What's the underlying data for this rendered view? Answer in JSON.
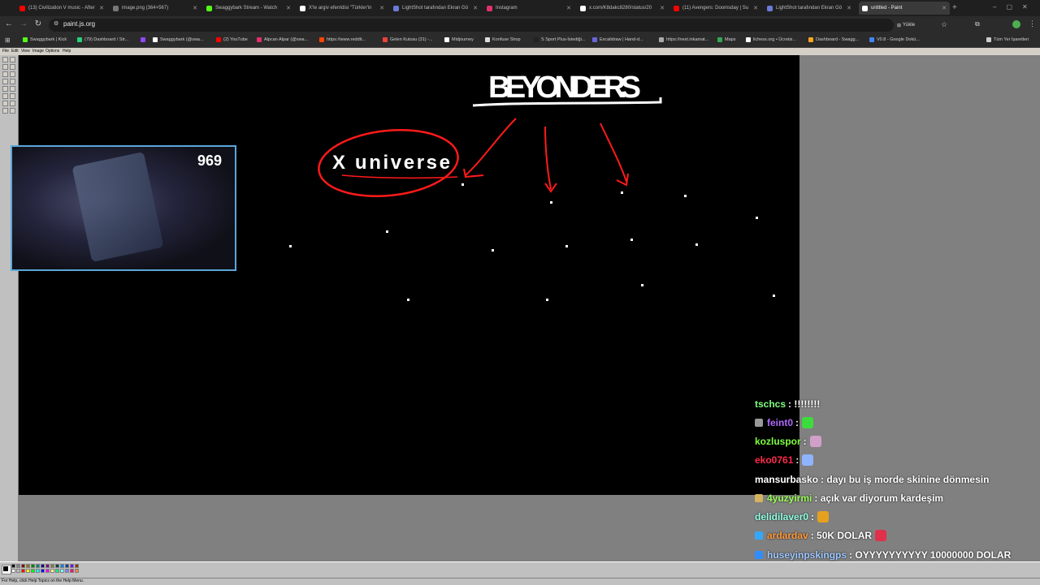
{
  "browser": {
    "tabs": [
      {
        "label": "(13) Civilization V music - After",
        "color": "#ff0000"
      },
      {
        "label": "image.png (364×567)",
        "color": "#777777"
      },
      {
        "label": "Swaggybark Stream - Watch",
        "color": "#53fc18"
      },
      {
        "label": "X'te argiv eferridisi \"Türkler'in",
        "color": "#ffffff"
      },
      {
        "label": "LightShot tarafından Ekran Gö",
        "color": "#6b7bd8"
      },
      {
        "label": "Instagram",
        "color": "#e1306c"
      },
      {
        "label": "x.com/K8dakc8280/status/20",
        "color": "#ffffff"
      },
      {
        "label": "(11) Avengers: Doomsday | Su",
        "color": "#ff0000"
      },
      {
        "label": "LightShot tarafından Ekran Gö",
        "color": "#6b7bd8"
      },
      {
        "label": "untitled - Paint",
        "color": "#ffffff"
      }
    ],
    "url": "paint.js.org",
    "install_label": "Yükle",
    "bookmarks": [
      {
        "label": "Swaggybark | Kick",
        "color": "#53fc18"
      },
      {
        "label": "(79) Dashboard / Str...",
        "color": "#26d07c"
      },
      {
        "label": "",
        "color": "#9146ff"
      },
      {
        "label": "Swaggybark (@swa...",
        "color": "#ffffff"
      },
      {
        "label": "(2) YouTube",
        "color": "#ff0000"
      },
      {
        "label": "Alpcan Alpar (@swa...",
        "color": "#e1306c"
      },
      {
        "label": "https://www.reddit...",
        "color": "#ff4500"
      },
      {
        "label": "Gelen Kutusu (31) -...",
        "color": "#ea4335"
      },
      {
        "label": "Midjourney",
        "color": "#ffffff"
      },
      {
        "label": "Konfuse Shop",
        "color": "#dddddd"
      },
      {
        "label": "S Sport Plus-İstediği...",
        "color": "#222222"
      },
      {
        "label": "Excalidraw | Hand-d...",
        "color": "#6965db"
      },
      {
        "label": "https://next.inkamat...",
        "color": "#aaaaaa"
      },
      {
        "label": "Maps",
        "color": "#34a853"
      },
      {
        "label": "lichess.org • Ücretsi...",
        "color": "#ffffff"
      },
      {
        "label": "Dashboard - Swagg...",
        "color": "#f5a623"
      },
      {
        "label": "V0.8 - Google Dokü...",
        "color": "#4285f4"
      }
    ],
    "all_bookmarks": "Tüm Yer İşaretleri"
  },
  "paint": {
    "menu": [
      "File",
      "Edit",
      "View",
      "Image",
      "Options",
      "Help"
    ],
    "status": "For Help, click Help Topics on the Help Menu.",
    "palette": [
      "#000000",
      "#808080",
      "#800000",
      "#808000",
      "#008000",
      "#008080",
      "#000080",
      "#800080",
      "#808040",
      "#004040",
      "#0080ff",
      "#004080",
      "#8000ff",
      "#804000",
      "#ffffff",
      "#c0c0c0",
      "#ff0000",
      "#ffff00",
      "#00ff00",
      "#00ffff",
      "#0000ff",
      "#ff00ff",
      "#ffff80",
      "#00ff80",
      "#80ffff",
      "#8080ff",
      "#ff0080",
      "#ff8040"
    ],
    "drawing": {
      "heading": "BEYONDERS",
      "bubble": "X universe"
    }
  },
  "stream": {
    "viewer_count": "969",
    "chat": [
      {
        "user": "tschcs",
        "user_color": "#7fff7f",
        "message": ": !!!!!!!!",
        "badge": "",
        "emote": ""
      },
      {
        "user": "feint0",
        "user_color": "#b06aff",
        "message": ":",
        "badge": "#999999",
        "emote": "#3ddc3d"
      },
      {
        "user": "kozluspor",
        "user_color": "#7fff3f",
        "message": ":",
        "badge": "",
        "emote": "#d0a0c8"
      },
      {
        "user": "eko0761",
        "user_color": "#ff2a4a",
        "message": ":",
        "badge": "",
        "emote": "#8fb4ff"
      },
      {
        "user": "mansurbasko",
        "user_color": "#ffffff",
        "message": ": dayı bu iş morde skinine dönmesin",
        "badge": "",
        "emote": ""
      },
      {
        "user": "4yuzyirmi",
        "user_color": "#9cff5a",
        "message": ": açık var diyorum kardeşim",
        "badge": "#d6b25e",
        "emote": ""
      },
      {
        "user": "delidilaver0",
        "user_color": "#8fffe0",
        "message": ":",
        "badge": "",
        "emote": "#e6a020"
      },
      {
        "user": "ardardav",
        "user_color": "#ff9a3c",
        "message": ": 50K DOLAR",
        "badge": "#35a7ff",
        "emote": "#e0304a"
      },
      {
        "user": "huseyinpskingps",
        "user_color": "#9ec8ff",
        "message": ": OYYYYYYYYYY 10000000 DOLAR",
        "badge": "#2f8dff",
        "emote": ""
      }
    ]
  }
}
